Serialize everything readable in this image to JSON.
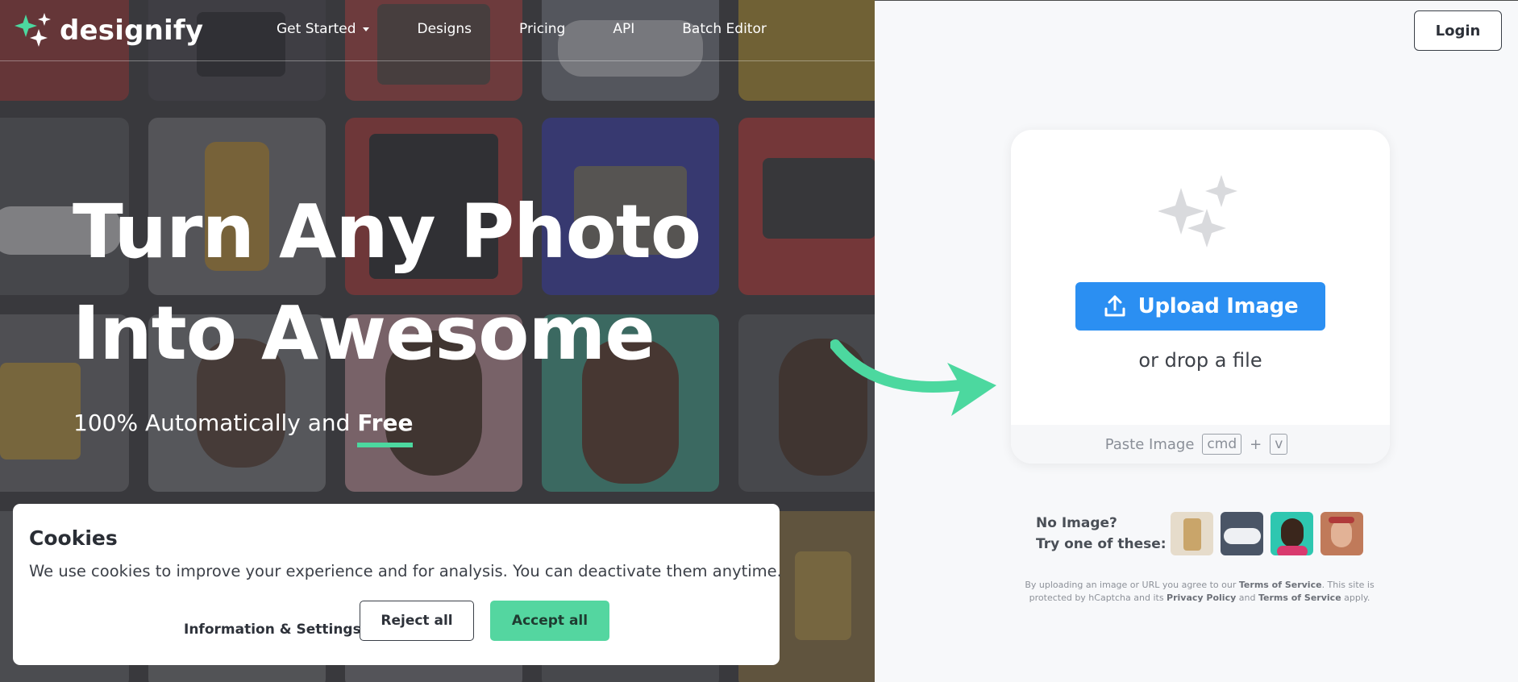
{
  "brand": {
    "name": "designify",
    "accent_color": "#4cd89f",
    "primary_button_color": "#2b8ff2"
  },
  "nav": {
    "items": [
      {
        "label": "Get Started",
        "has_dropdown": true
      },
      {
        "label": "Designs"
      },
      {
        "label": "Pricing"
      },
      {
        "label": "API"
      },
      {
        "label": "Batch Editor"
      }
    ],
    "login_label": "Login"
  },
  "hero": {
    "headline_line1": "Turn Any Photo",
    "headline_line2": "Into Awesome",
    "subline_prefix": "100% Automatically and ",
    "subline_emphasis": "Free"
  },
  "upload": {
    "button_label": "Upload Image",
    "drop_text": "or drop a file",
    "paste_label": "Paste Image",
    "paste_key1": "cmd",
    "paste_plus": "+",
    "paste_key2": "v",
    "try_line1": "No Image?",
    "try_line2": "Try one of these:",
    "samples": [
      "sample-product-icon",
      "sample-car-icon",
      "sample-man-icon",
      "sample-woman-icon"
    ]
  },
  "legal": {
    "prefix": "By uploading an image or URL you agree to our ",
    "tos1": "Terms of Service",
    "mid1": ". This site is protected by hCaptcha and its ",
    "privacy": "Privacy Policy",
    "and": " and ",
    "tos2": "Terms of Service",
    "suffix": " apply."
  },
  "cookies": {
    "title": "Cookies",
    "text": "We use cookies to improve your experience and for analysis. You can deactivate them anytime.",
    "info_label": "Information & Settings",
    "reject_label": "Reject all",
    "accept_label": "Accept all"
  }
}
